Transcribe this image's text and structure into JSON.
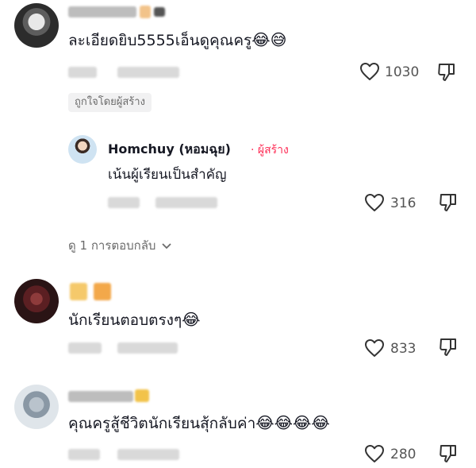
{
  "comments": [
    {
      "text": "ละเอียดยิบ5555เอ็นดูคุณครู",
      "emojis": [
        "😂",
        "😅"
      ],
      "likes": "1030",
      "liked_by_creator": "ถูกใจโดยผู้สร้าง",
      "reply": {
        "author": "Homchuy  (หอมฉุย)",
        "creator_tag": "· ผู้สร้าง",
        "text": "เน้นผู้เรียนเป็นสำคัญ",
        "likes": "316"
      },
      "view_replies": "ดู 1 การตอบกลับ"
    },
    {
      "text": "นักเรียนตอบตรงๆ",
      "emojis": [
        "😂"
      ],
      "likes": "833"
    },
    {
      "text": "คุณครูสู้ชีวิตนักเรียนสุ้กลับค่า",
      "emojis": [
        "😂",
        "😂",
        "😂",
        "😂"
      ],
      "likes": "280"
    }
  ],
  "icons": {
    "like": "heart-outline-icon",
    "dislike": "thumbs-down-outline-icon",
    "expand": "chevron-down-icon"
  },
  "colors": {
    "creator_accent": "#fe2c55",
    "text_primary": "#161823",
    "text_secondary": "#6b6b6b"
  }
}
